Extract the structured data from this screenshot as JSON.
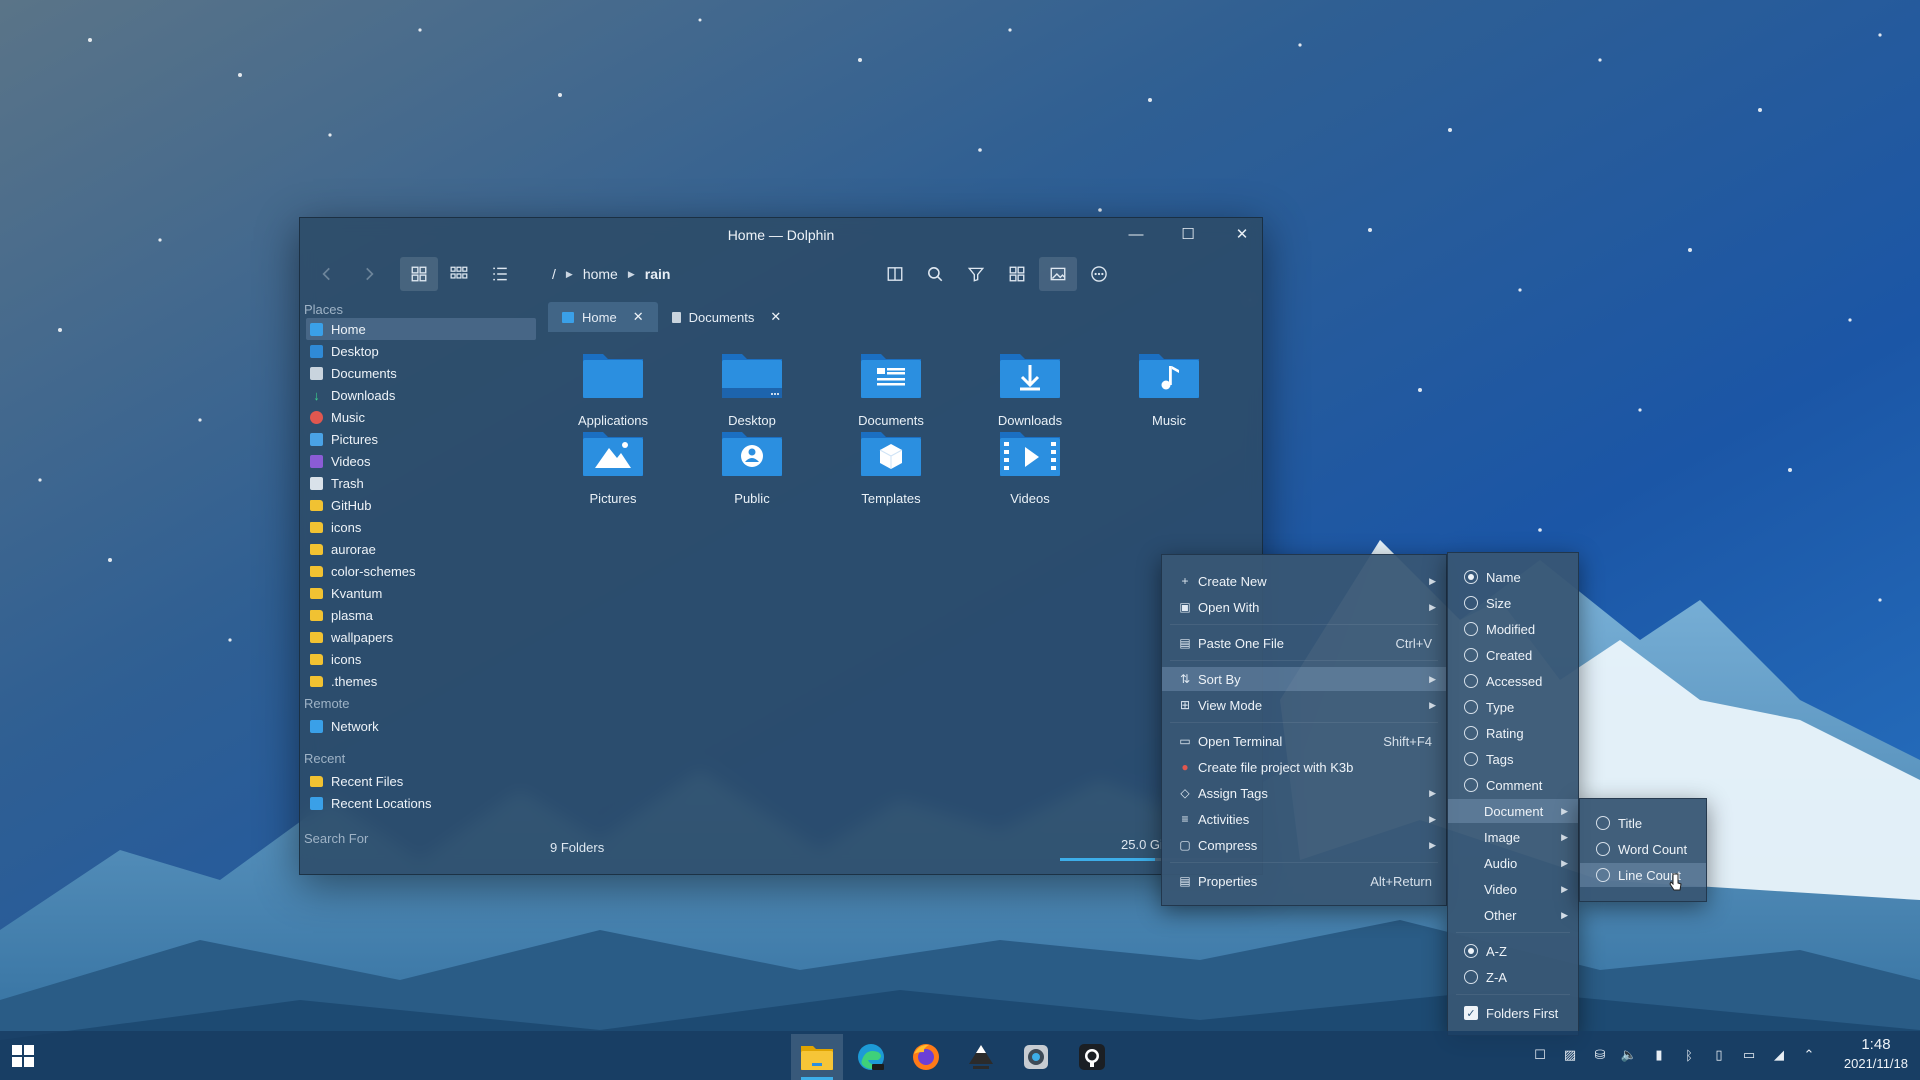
{
  "window": {
    "title": "Home — Dolphin",
    "breadcrumb": [
      "/",
      "home",
      "rain"
    ]
  },
  "sidebar": {
    "places_header": "Places",
    "places": [
      {
        "label": "Home",
        "icon": "home-icon",
        "selected": true
      },
      {
        "label": "Desktop",
        "icon": "desktop-icon"
      },
      {
        "label": "Documents",
        "icon": "documents-icon"
      },
      {
        "label": "Downloads",
        "icon": "downloads-icon"
      },
      {
        "label": "Music",
        "icon": "music-icon"
      },
      {
        "label": "Pictures",
        "icon": "pictures-icon"
      },
      {
        "label": "Videos",
        "icon": "videos-icon"
      },
      {
        "label": "Trash",
        "icon": "trash-icon"
      },
      {
        "label": "GitHub",
        "icon": "folder-icon"
      },
      {
        "label": "icons",
        "icon": "folder-icon"
      },
      {
        "label": "aurorae",
        "icon": "folder-icon"
      },
      {
        "label": "color-schemes",
        "icon": "folder-icon"
      },
      {
        "label": "Kvantum",
        "icon": "folder-icon"
      },
      {
        "label": "plasma",
        "icon": "folder-icon"
      },
      {
        "label": "wallpapers",
        "icon": "folder-icon"
      },
      {
        "label": "icons",
        "icon": "folder-icon"
      },
      {
        "label": ".themes",
        "icon": "folder-icon"
      }
    ],
    "remote_header": "Remote",
    "remote": [
      {
        "label": "Network",
        "icon": "network-icon"
      }
    ],
    "recent_header": "Recent",
    "recent": [
      {
        "label": "Recent Files",
        "icon": "recent-files-icon"
      },
      {
        "label": "Recent Locations",
        "icon": "recent-locations-icon"
      }
    ],
    "search_header": "Search For"
  },
  "tabs": [
    {
      "label": "Home",
      "active": true
    },
    {
      "label": "Documents",
      "active": false
    }
  ],
  "folders": [
    {
      "label": "Applications",
      "icon": "applications-folder-icon"
    },
    {
      "label": "Desktop",
      "icon": "desktop-folder-icon"
    },
    {
      "label": "Documents",
      "icon": "documents-folder-icon"
    },
    {
      "label": "Downloads",
      "icon": "downloads-folder-icon"
    },
    {
      "label": "Music",
      "icon": "music-folder-icon"
    },
    {
      "label": "Pictures",
      "icon": "pictures-folder-icon"
    },
    {
      "label": "Public",
      "icon": "public-folder-icon"
    },
    {
      "label": "Templates",
      "icon": "templates-folder-icon"
    },
    {
      "label": "Videos",
      "icon": "videos-folder-icon"
    }
  ],
  "status": {
    "count": "9 Folders",
    "free_space": "25.0 Gi"
  },
  "context_menu": {
    "items": [
      {
        "label": "Create New",
        "submenu": true
      },
      {
        "label": "Open With",
        "submenu": true
      },
      {
        "label": "Paste One File",
        "shortcut": "Ctrl+V"
      },
      {
        "label": "Sort By",
        "submenu": true,
        "highlighted": true
      },
      {
        "label": "View Mode",
        "submenu": true
      },
      {
        "label": "Open Terminal",
        "shortcut": "Shift+F4"
      },
      {
        "label": "Create file project with K3b"
      },
      {
        "label": "Assign Tags",
        "submenu": true
      },
      {
        "label": "Activities",
        "submenu": true
      },
      {
        "label": "Compress",
        "submenu": true
      },
      {
        "label": "Properties",
        "shortcut": "Alt+Return"
      }
    ]
  },
  "sort_menu": {
    "options": [
      "Name",
      "Size",
      "Modified",
      "Created",
      "Accessed",
      "Type",
      "Rating",
      "Tags",
      "Comment"
    ],
    "selected": "Name",
    "groups": [
      "Document",
      "Image",
      "Audio",
      "Video",
      "Other"
    ],
    "order": [
      "A-Z",
      "Z-A"
    ],
    "order_selected": "A-Z",
    "folders_first": "Folders First",
    "folders_first_checked": true
  },
  "document_menu": {
    "options": [
      "Title",
      "Word Count",
      "Line Count"
    ]
  },
  "taskbar": {
    "apps": [
      "file-manager-icon",
      "edge-dev-icon",
      "firefox-icon",
      "inkscape-icon",
      "settings-icon",
      "github-icon"
    ],
    "time": "1:48",
    "date": "2021/11/18"
  },
  "colors": {
    "accent": "#3daee9",
    "folder_blue": "#2b8fe0",
    "folder_yellow": "#f1c232"
  }
}
